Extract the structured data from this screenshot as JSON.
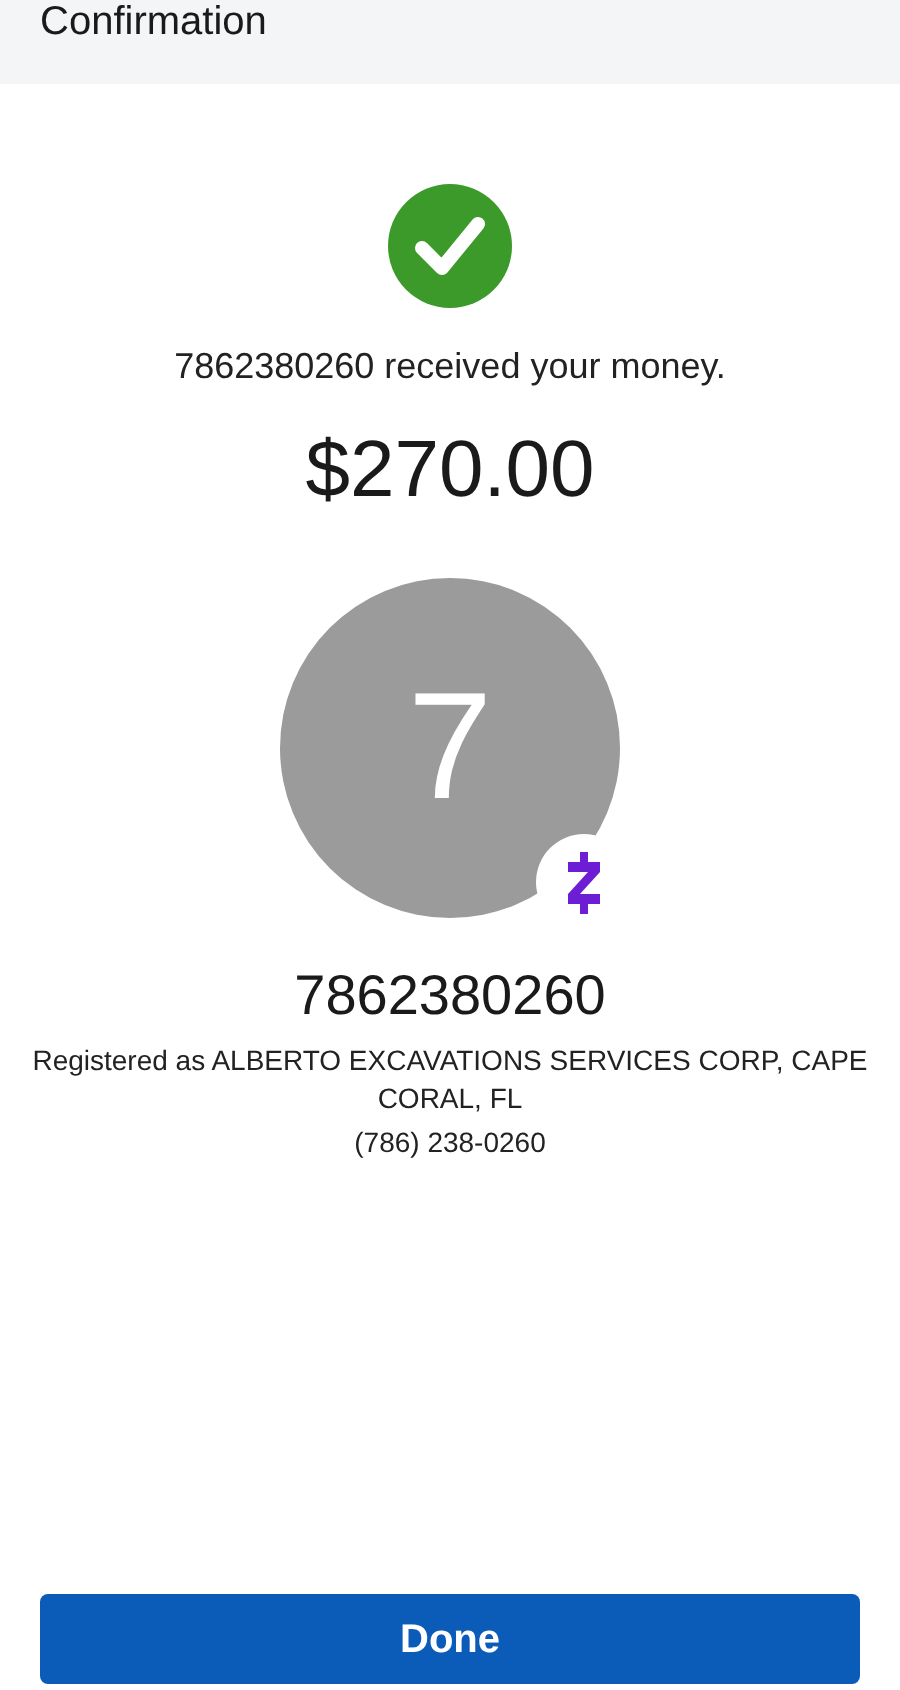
{
  "header": {
    "title": "Confirmation"
  },
  "success": {
    "message": "7862380260 received your money.",
    "amount": "$270.00"
  },
  "recipient": {
    "initial": "7",
    "name": "7862380260",
    "registered": "Registered as ALBERTO EXCAVATIONS SERVICES CORP, CAPE CORAL, FL",
    "phone": "(786) 238-0260"
  },
  "buttons": [
    {
      "label": "Done"
    }
  ]
}
